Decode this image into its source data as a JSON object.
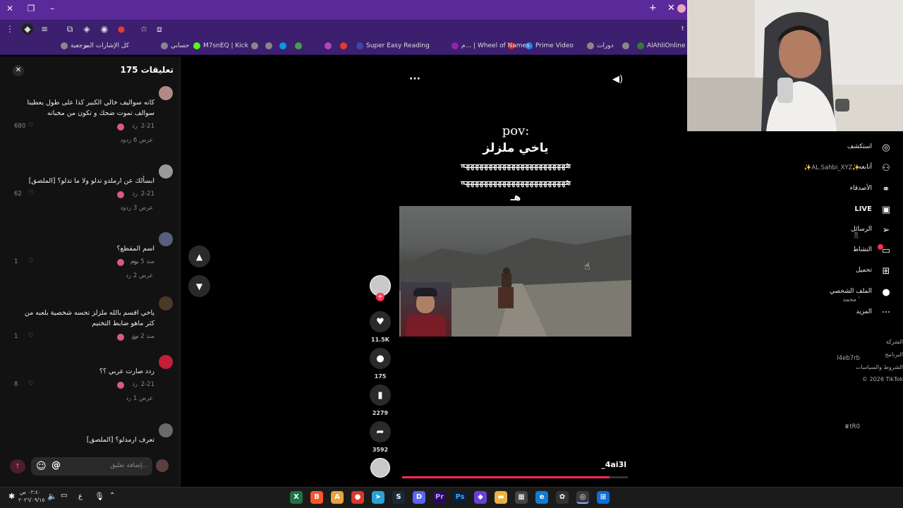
{
  "browser": {
    "toolbar_url": "t",
    "bookmarks": [
      {
        "label": "AlAhliOnline",
        "color": "#2e7d32"
      },
      {
        "label": "",
        "color": "#888888"
      },
      {
        "label": "دورات",
        "color": "#888888"
      },
      {
        "label": "Prime Video",
        "color": "#1e88e5"
      },
      {
        "label": "",
        "color": "#c62828"
      },
      {
        "label": "م... | Wheel of Names",
        "color": "#8e24aa"
      },
      {
        "label": "Super Easy Reading",
        "color": "#3949ab"
      },
      {
        "label": "",
        "color": "#e53935"
      },
      {
        "label": "",
        "color": "#ab47bc"
      },
      {
        "label": "",
        "color": "#43a047"
      },
      {
        "label": "",
        "color": "#039be5"
      },
      {
        "label": "",
        "color": "#888888"
      },
      {
        "label": "",
        "color": "#888888"
      },
      {
        "label": "M7snEQ | Kick",
        "color": "#53fc18"
      },
      {
        "label": "حسابي",
        "color": "#888888"
      },
      {
        "label": "كل الإشارات المرجعية",
        "color": "#888888"
      }
    ]
  },
  "comments": {
    "header": "تعليقات 175",
    "input_placeholder": "إضافة تعليق...",
    "items": [
      {
        "user": "BESO",
        "text": "كانه سواليف خالي الكبير كذا على طول يعطينا سوالف تموت ضحك و تكون من مخباته",
        "date": "2-21",
        "reply": "رد",
        "likes": "680",
        "replies": "عرض 6 ردود"
      },
      {
        "user": "✨AL.Sahbi_XYZ✨",
        "text": "ابسألك عن ارملدو تدلو ولا ما تدلو؟ [الملصق]",
        "date": "2-21",
        "reply": "رد",
        "likes": "62",
        "replies": "عرض 3 ردود"
      },
      {
        "user": "🎗",
        "text": "اسم المقطع؟",
        "date": "منذ 5 يوم",
        "reply": "رد",
        "likes": "1",
        "replies": "عرض 2 رد"
      },
      {
        "user": "محمد '",
        "text": "ياخي اقسم بالله ملزلز تحسه شخصية بلعبه من كثر ماهو ضابط التختيم",
        "date": "منذ 2 س",
        "reply": "رد",
        "likes": "1",
        "replies": ""
      },
      {
        "user": "l4eb7rb",
        "text": "ردد صارت عربي ؟؟",
        "date": "2-21",
        "reply": "رد",
        "likes": "8",
        "replies": "عرض 1 رد"
      },
      {
        "user": "♛tR0",
        "text": "تعرف ارمدلو؟ [الملصق]",
        "date": "",
        "reply": "",
        "likes": "",
        "replies": ""
      }
    ]
  },
  "video": {
    "title": "pov:",
    "line2": "ياخي ملزلز",
    "laugh1": "هههههههههههههههههههههههه",
    "laugh2": "هههههههههههههههههههههههه",
    "laugh3": "هـ",
    "author": "_4ai3l",
    "likes": "11.5K",
    "comments": "175",
    "saves": "2279",
    "shares": "3592",
    "progress": 0.92
  },
  "right_nav": [
    {
      "label": "استكشف",
      "icon": "compass-icon"
    },
    {
      "label": "أتابعه",
      "icon": "user-plus-icon"
    },
    {
      "label": "الأصدقاء",
      "icon": "friends-icon"
    },
    {
      "label": "LIVE",
      "icon": "live-icon"
    },
    {
      "label": "الرسائل",
      "icon": "send-icon"
    },
    {
      "label": "النشاط",
      "icon": "activity-icon"
    },
    {
      "label": "تحميل",
      "icon": "upload-icon"
    },
    {
      "label": "الملف الشخصي",
      "icon": "profile-icon"
    },
    {
      "label": "المزيد",
      "icon": "more-icon"
    }
  ],
  "footer_links": [
    "الشركة",
    "البرنامج",
    "الشروط والسياسات",
    "© 2026 TikTok"
  ],
  "taskbar": {
    "time": "٠٢:٤٠ ص",
    "date": "٢٠٢٦/٠٩/١٥",
    "lang": "ع"
  }
}
